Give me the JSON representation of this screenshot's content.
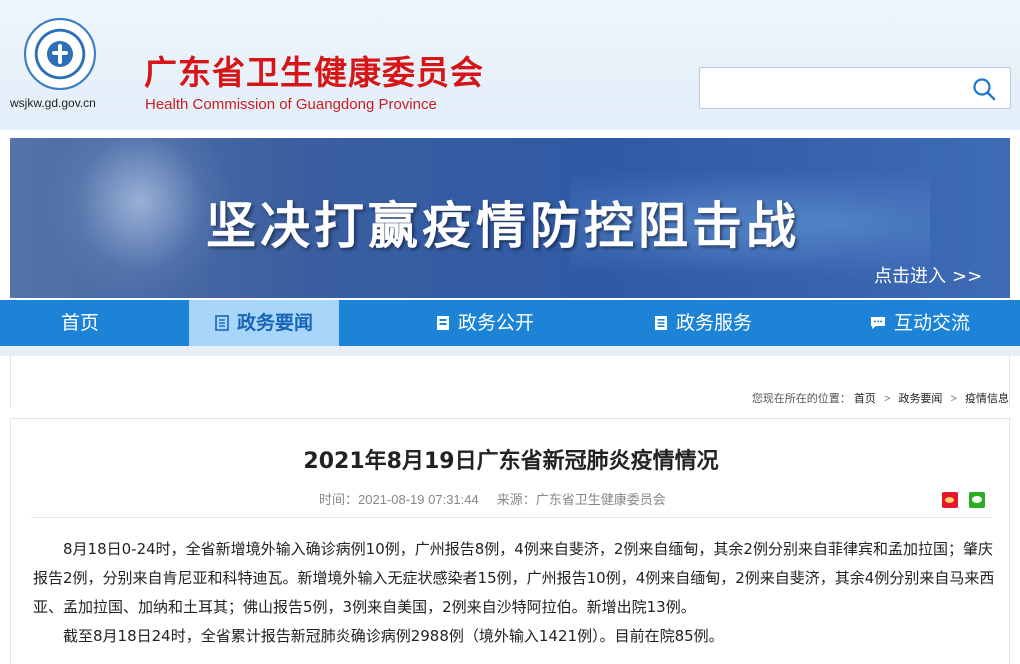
{
  "header": {
    "domain": "wsjkw.gd.gov.cn",
    "title": "广东省卫生健康委员会",
    "subtitle": "Health Commission of Guangdong Province",
    "search": {
      "value": "",
      "placeholder": ""
    }
  },
  "banner": {
    "title": "坚决打赢疫情防控阻击战",
    "enter_label": "点击进入",
    "enter_arrow": ">>"
  },
  "nav": {
    "items": [
      {
        "label": "首页",
        "active": false,
        "icon": ""
      },
      {
        "label": "政务要闻",
        "active": true,
        "icon": "news-icon"
      },
      {
        "label": "政务公开",
        "active": false,
        "icon": "document-icon"
      },
      {
        "label": "政务服务",
        "active": false,
        "icon": "list-icon"
      },
      {
        "label": "互动交流",
        "active": false,
        "icon": "chat-icon"
      }
    ]
  },
  "breadcrumb": {
    "prefix": "您现在所在的位置：",
    "items": [
      "首页",
      "政务要闻",
      "疫情信息"
    ],
    "separator": ">"
  },
  "article": {
    "title": "2021年8月19日广东省新冠肺炎疫情情况",
    "time_label": "时间：",
    "time": "2021-08-19 07:31:44",
    "source_label": "来源：",
    "source": "广东省卫生健康委员会",
    "paragraphs": [
      "8月18日0-24时，全省新增境外输入确诊病例10例，广州报告8例，4例来自斐济，2例来自缅甸，其余2例分别来自菲律宾和孟加拉国；肇庆报告2例，分别来自肯尼亚和科特迪瓦。新增境外输入无症状感染者15例，广州报告10例，4例来自缅甸，2例来自斐济，其余4例分别来自马来西亚、孟加拉国、加纳和土耳其；佛山报告5例，3例来自美国，2例来自沙特阿拉伯。新增出院13例。",
      "截至8月18日24时，全省累计报告新冠肺炎确诊病例2988例（境外输入1421例）。目前在院85例。"
    ]
  },
  "colors": {
    "brand_red": "#d61517",
    "nav_blue": "#1c83d6",
    "nav_active_bg": "#a7d6fa",
    "nav_active_text": "#1a64b6"
  }
}
